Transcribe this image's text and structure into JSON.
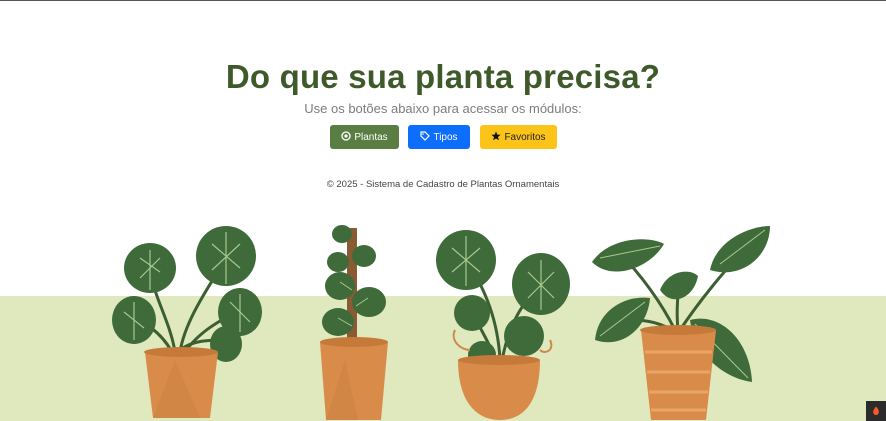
{
  "header": {
    "title": "Do que sua planta precisa?",
    "subtitle": "Use os botões abaixo para acessar os módulos:"
  },
  "buttons": {
    "plantas": {
      "label": "Plantas",
      "icon": "flower-icon",
      "color": "#5a7d44"
    },
    "tipos": {
      "label": "Tipos",
      "icon": "tag-icon",
      "color": "#0d6efd"
    },
    "favoritos": {
      "label": "Favoritos",
      "icon": "star-icon",
      "color": "#fcc419"
    }
  },
  "footer": {
    "text": "© 2025 - Sistema de Cadastro de Plantas Ornamentais"
  },
  "colors": {
    "title": "#3f5a2a",
    "ground": "#dfe9bd",
    "pot": "#d98c4a",
    "leaf": "#3f6b3a"
  },
  "illustration": {
    "plants": [
      "monstera-plant",
      "climbing-pothos-plant",
      "hanging-monstera-plant",
      "calathea-plant"
    ]
  }
}
